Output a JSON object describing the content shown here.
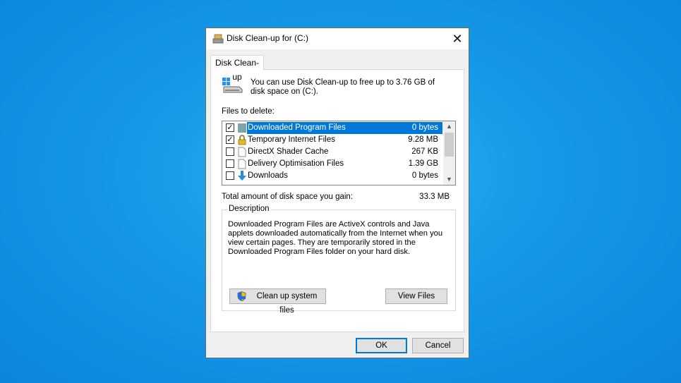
{
  "window": {
    "title": "Disk Clean-up for  (C:)",
    "close_glyph": "✕"
  },
  "tab": {
    "label": "Disk Clean-up"
  },
  "intro": {
    "text": "You can use Disk Clean-up to free up to 3.76 GB of disk space on  (C:)."
  },
  "files_label": "Files to delete:",
  "files": [
    {
      "name": "Downloaded Program Files",
      "size": "0 bytes",
      "checked": true,
      "selected": true,
      "icon": "folder-icon"
    },
    {
      "name": "Temporary Internet Files",
      "size": "9.28 MB",
      "checked": true,
      "selected": false,
      "icon": "lock-icon"
    },
    {
      "name": "DirectX Shader Cache",
      "size": "267 KB",
      "checked": false,
      "selected": false,
      "icon": "file-icon"
    },
    {
      "name": "Delivery Optimisation Files",
      "size": "1.39 GB",
      "checked": false,
      "selected": false,
      "icon": "file-icon"
    },
    {
      "name": "Downloads",
      "size": "0 bytes",
      "checked": false,
      "selected": false,
      "icon": "download-arrow-icon"
    }
  ],
  "total": {
    "label": "Total amount of disk space you gain:",
    "value": "33.3 MB"
  },
  "description": {
    "legend": "Description",
    "text": "Downloaded Program Files are ActiveX controls and Java applets downloaded automatically from the Internet when you view certain pages. They are temporarily stored in the Downloaded Program Files folder on your hard disk."
  },
  "buttons": {
    "cleanup": "Clean up system files",
    "view_files": "View Files",
    "ok": "OK",
    "cancel": "Cancel"
  },
  "colors": {
    "selection": "#0078d7",
    "desktop": "#1598e6"
  }
}
